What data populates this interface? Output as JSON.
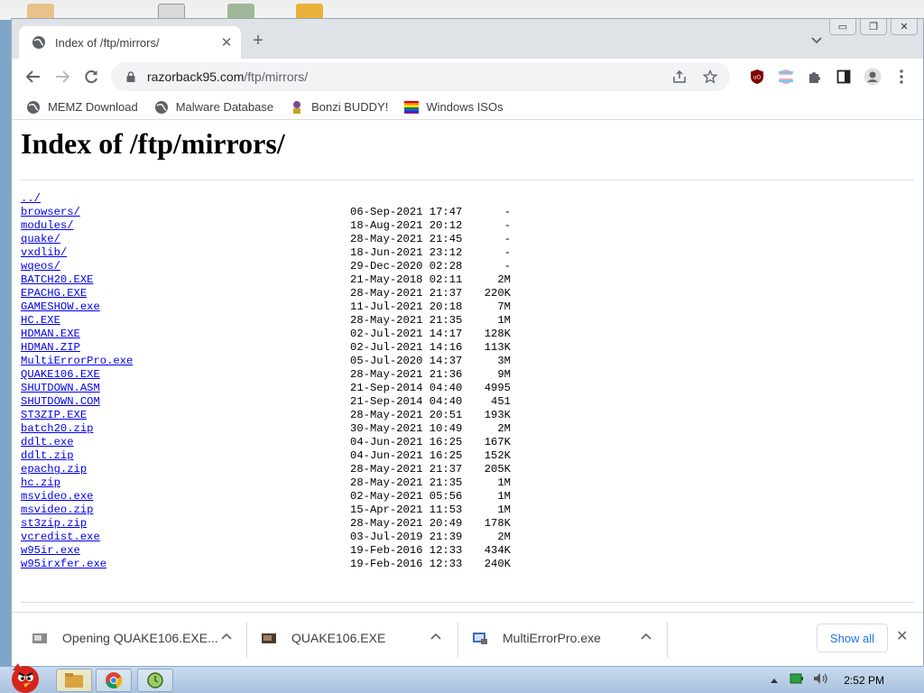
{
  "browser": {
    "tab_title": "Index of /ftp/mirrors/",
    "new_tab_label": "+",
    "url_host": "razorback95.com",
    "url_path": "/ftp/mirrors/",
    "bookmarks": [
      {
        "label": "MEMZ Download",
        "icon": "globe-icon"
      },
      {
        "label": "Malware Database",
        "icon": "globe-icon"
      },
      {
        "label": "Bonzi BUDDY!",
        "icon": "bonzi-icon"
      },
      {
        "label": "Windows ISOs",
        "icon": "windows-flag-icon"
      }
    ]
  },
  "page": {
    "title": "Index of /ftp/mirrors/",
    "entries": [
      {
        "name": "../",
        "date": "",
        "size": ""
      },
      {
        "name": "browsers/",
        "date": "06-Sep-2021 17:47",
        "size": "-"
      },
      {
        "name": "modules/",
        "date": "18-Aug-2021 20:12",
        "size": "-"
      },
      {
        "name": "quake/",
        "date": "28-May-2021 21:45",
        "size": "-"
      },
      {
        "name": "vxdlib/",
        "date": "18-Jun-2021 23:12",
        "size": "-"
      },
      {
        "name": "wqeos/",
        "date": "29-Dec-2020 02:28",
        "size": "-"
      },
      {
        "name": "BATCH20.EXE",
        "date": "21-May-2018 02:11",
        "size": "2M"
      },
      {
        "name": "EPACHG.EXE",
        "date": "28-May-2021 21:37",
        "size": "220K"
      },
      {
        "name": "GAMESHOW.exe",
        "date": "11-Jul-2021 20:18",
        "size": "7M"
      },
      {
        "name": "HC.EXE",
        "date": "28-May-2021 21:35",
        "size": "1M"
      },
      {
        "name": "HDMAN.EXE",
        "date": "02-Jul-2021 14:17",
        "size": "128K"
      },
      {
        "name": "HDMAN.ZIP",
        "date": "02-Jul-2021 14:16",
        "size": "113K"
      },
      {
        "name": "MultiErrorPro.exe",
        "date": "05-Jul-2020 14:37",
        "size": "3M"
      },
      {
        "name": "QUAKE106.EXE",
        "date": "28-May-2021 21:36",
        "size": "9M"
      },
      {
        "name": "SHUTDOWN.ASM",
        "date": "21-Sep-2014 04:40",
        "size": "4995"
      },
      {
        "name": "SHUTDOWN.COM",
        "date": "21-Sep-2014 04:40",
        "size": "451"
      },
      {
        "name": "ST3ZIP.EXE",
        "date": "28-May-2021 20:51",
        "size": "193K"
      },
      {
        "name": "batch20.zip",
        "date": "30-May-2021 10:49",
        "size": "2M"
      },
      {
        "name": "ddlt.exe",
        "date": "04-Jun-2021 16:25",
        "size": "167K"
      },
      {
        "name": "ddlt.zip",
        "date": "04-Jun-2021 16:25",
        "size": "152K"
      },
      {
        "name": "epachg.zip",
        "date": "28-May-2021 21:37",
        "size": "205K"
      },
      {
        "name": "hc.zip",
        "date": "28-May-2021 21:35",
        "size": "1M"
      },
      {
        "name": "msvideo.exe",
        "date": "02-May-2021 05:56",
        "size": "1M"
      },
      {
        "name": "msvideo.zip",
        "date": "15-Apr-2021 11:53",
        "size": "1M"
      },
      {
        "name": "st3zip.zip",
        "date": "28-May-2021 20:49",
        "size": "178K"
      },
      {
        "name": "vcredist.exe",
        "date": "03-Jul-2019 21:39",
        "size": "2M"
      },
      {
        "name": "w95ir.exe",
        "date": "19-Feb-2016 12:33",
        "size": "434K"
      },
      {
        "name": "w95irxfer.exe",
        "date": "19-Feb-2016 12:33",
        "size": "240K"
      }
    ]
  },
  "downloads": {
    "items": [
      {
        "label": "Opening QUAKE106.EXE...",
        "icon": "installer-icon"
      },
      {
        "label": "QUAKE106.EXE",
        "icon": "installer-icon"
      },
      {
        "label": "MultiErrorPro.exe",
        "icon": "exe-icon"
      }
    ],
    "show_all_label": "Show all"
  },
  "taskbar": {
    "clock": "2:52 PM"
  },
  "colors": {
    "link": "#0000ee",
    "accent": "#1a73e8",
    "tab_strip": "#dfe3e8"
  }
}
